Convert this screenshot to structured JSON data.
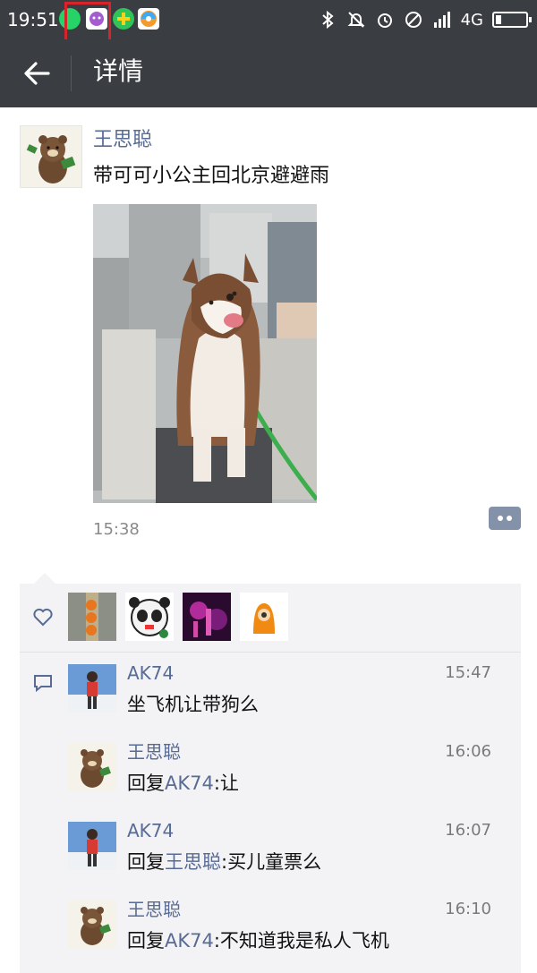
{
  "status_bar": {
    "time": "19:51",
    "network": "4G",
    "icons": [
      "whatsapp-icon",
      "app-icon",
      "plus-icon",
      "browser-icon",
      "bluetooth-icon",
      "mute-icon",
      "alarm-icon",
      "block-icon",
      "signal-icon",
      "battery-icon"
    ]
  },
  "header": {
    "back_icon": "arrow-left-icon",
    "title": "详情"
  },
  "post": {
    "author": "王思聪",
    "text": "带可可小公主回北京避避雨",
    "time": "15:38",
    "comment_button_icon": "more-dots-icon"
  },
  "likes": {
    "icon": "heart-icon",
    "avatars": [
      "avatar-oranges",
      "avatar-panda",
      "avatar-concert",
      "avatar-cartoon"
    ]
  },
  "comments": {
    "icon": "comment-icon",
    "items": [
      {
        "name": "AK74",
        "time": "15:47",
        "text": "坐飞机让带狗么"
      },
      {
        "name": "王思聪",
        "time": "16:06",
        "reply_prefix": "回复",
        "reply_to": "AK74",
        "text": ":让"
      },
      {
        "name": "AK74",
        "time": "16:07",
        "reply_prefix": "回复",
        "reply_to": "王思聪",
        "text": ":买儿童票么"
      },
      {
        "name": "王思聪",
        "time": "16:10",
        "reply_prefix": "回复",
        "reply_to": "AK74",
        "text": ":不知道我是私人飞机"
      }
    ]
  },
  "colors": {
    "header_bg": "#3a3d42",
    "link": "#576b95",
    "panel_bg": "#f3f3f5",
    "highlight": "#d8232a"
  }
}
